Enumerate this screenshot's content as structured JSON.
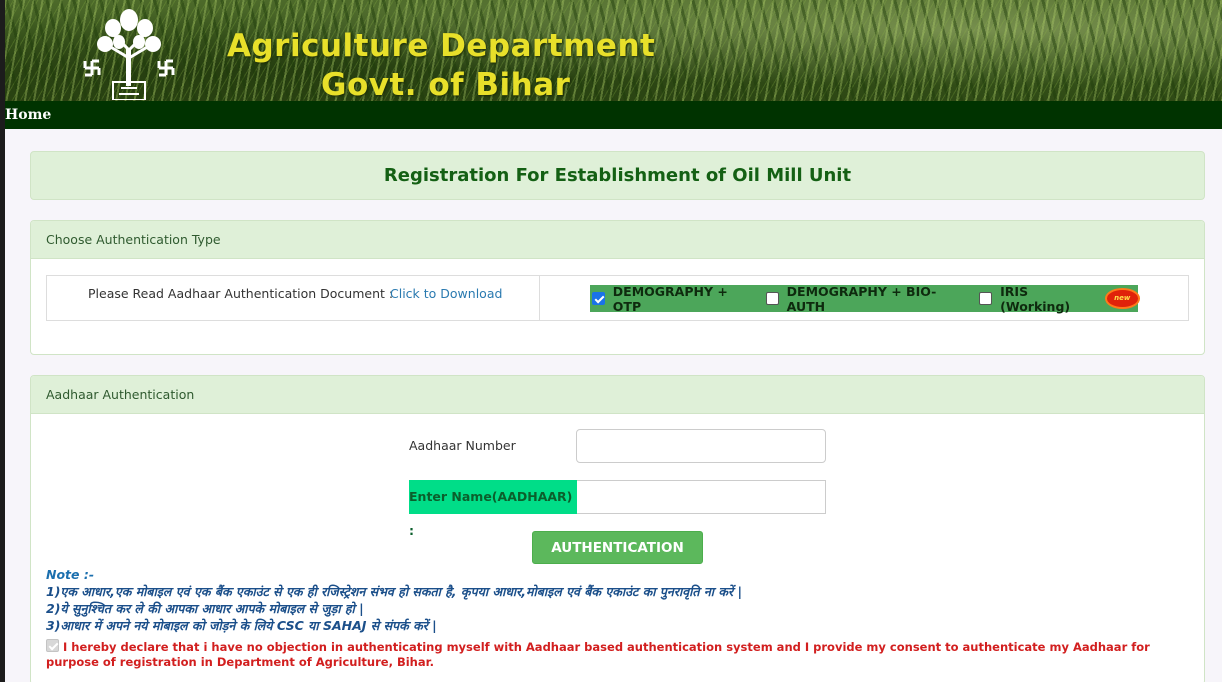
{
  "header": {
    "title": "Agriculture Department",
    "subtitle": "Govt. of Bihar",
    "logo_icon": "bihar-emblem-tree-icon"
  },
  "nav": {
    "home": "Home"
  },
  "page_title": "Registration For Establishment of Oil Mill Unit",
  "auth_type": {
    "heading": "Choose Authentication Type",
    "read_doc": "Please Read Aadhaar Authentication Document :",
    "download_link": "Click to Download",
    "options": [
      {
        "label": "DEMOGRAPHY + OTP",
        "checked": true
      },
      {
        "label": "DEMOGRAPHY + BIO-AUTH",
        "checked": false
      },
      {
        "label": "IRIS (Working)",
        "checked": false
      }
    ],
    "new_badge": "new"
  },
  "aadhaar": {
    "heading": "Aadhaar Authentication",
    "number_label": "Aadhaar Number",
    "number_value": "",
    "name_label": "Enter Name(AADHAAR) :",
    "name_value": "",
    "button": "AUTHENTICATION"
  },
  "notes": {
    "title": "Note :-",
    "lines": [
      "1)एक आधार,एक मोबाइल एवं एक बैंक एकाउंट से एक ही रजिस्ट्रेशन संभव हो सकता है, कृपया आधार,मोबाइल एवं बैंक एकाउंट का पुनरावृति ना करें |",
      "2)ये सुनुश्चित कर ले की आपका आधार आपके मोबाइल से जुड़ा हो |",
      "3)आधार में अपने नये मोबाइल को जोड़ने के लिये CSC या SAHAJ से संपर्क करें |"
    ]
  },
  "consent": {
    "checked": true,
    "text": "I hereby declare that i have no objection in authenticating myself with Aadhaar based authentication system and I provide my consent to authenticate my Aadhaar for purpose of registration in Department of Agriculture, Bihar."
  },
  "colors": {
    "header_text": "#e8e02a",
    "nav_bg": "#003300",
    "panel_bg": "#dff0d8",
    "title_green": "#146014",
    "option_bar": "#4ca65a",
    "name_label_bg": "#00dd88",
    "button_bg": "#5cb85c",
    "consent_red": "#d21f1f",
    "note_blue": "#1b4f8a"
  }
}
